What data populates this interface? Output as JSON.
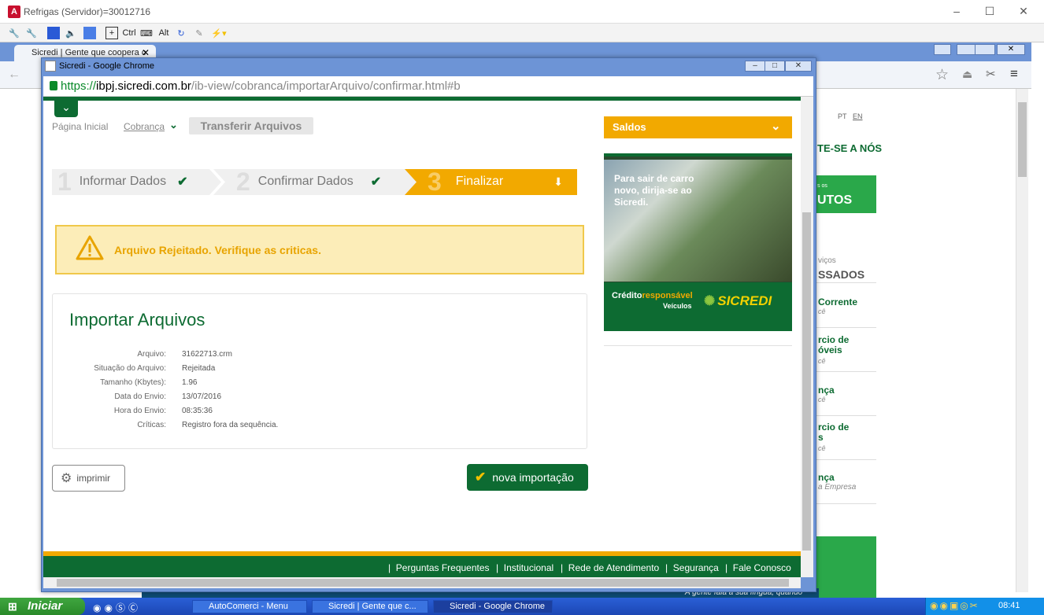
{
  "remote_window": {
    "title": "Refrigas (Servidor)=30012716",
    "toolbar": {
      "ctrl": "Ctrl",
      "alt": "Alt"
    }
  },
  "outer_browser": {
    "tab_label": "Sicredi | Gente que coopera c",
    "lang": {
      "pt": "PT",
      "en": "EN"
    },
    "side_heading": "TE-SE A NÓS",
    "green_block": {
      "small": "s os",
      "big": "UTOS"
    },
    "services_small": "viços",
    "services_heading": "SSADOS",
    "services": [
      {
        "title": "Corrente",
        "sub": "cê"
      },
      {
        "title": "rcio de\nóveis",
        "sub": "cê"
      },
      {
        "title": "nça",
        "sub": "cê"
      },
      {
        "title": "rcio de\ns",
        "sub": "cê"
      },
      {
        "title": "nça",
        "sub": "a Empresa"
      }
    ],
    "bottom_text": "A gente fala a sua língua, quando"
  },
  "popup": {
    "title": "Sicredi - Google Chrome",
    "url": {
      "scheme": "https://",
      "host": "ibpj.sicredi.com.br",
      "path": "/ib-view/cobranca/importarArquivo/confirmar.html#b"
    },
    "breadcrumb": {
      "home": "Página Inicial",
      "cobranca": "Cobrança",
      "current": "Transferir Arquivos"
    },
    "steps": [
      {
        "num": "1",
        "label": "Informar Dados"
      },
      {
        "num": "2",
        "label": "Confirmar Dados"
      },
      {
        "num": "3",
        "label": "Finalizar"
      }
    ],
    "alert": "Arquivo Rejeitado. Verifique as criticas.",
    "card": {
      "title": "Importar Arquivos",
      "rows": [
        {
          "label": "Arquivo:",
          "value": "31622713.crm"
        },
        {
          "label": "Situação do Arquivo:",
          "value": "Rejeitada"
        },
        {
          "label": "Tamanho (Kbytes):",
          "value": "1.96"
        },
        {
          "label": "Data do Envio:",
          "value": "13/07/2016"
        },
        {
          "label": "Hora do Envio:",
          "value": "08:35:36"
        },
        {
          "label": "Críticas:",
          "value": "Registro fora da sequência."
        }
      ]
    },
    "buttons": {
      "print": "imprimir",
      "new_import": "nova importação"
    },
    "saldos": "Saldos",
    "ad": {
      "text": "Para sair de carro novo, dirija-se ao Sicredi.",
      "credit_a": "Crédito",
      "credit_b": "responsável",
      "vehicles": "Veículos",
      "logo": "SICREDI"
    },
    "footer": [
      "Perguntas Frequentes",
      "Institucional",
      "Rede de Atendimento",
      "Segurança",
      "Fale Conosco"
    ]
  },
  "taskbar": {
    "start": "Iniciar",
    "items": [
      "AutoComerci - Menu",
      "Sicredi | Gente que c...",
      "Sicredi - Google Chrome"
    ],
    "clock": "08:41"
  },
  "colors": {
    "brand_green": "#0d6b32",
    "brand_yellow": "#f2a900",
    "alert_bg": "#fcedb8"
  }
}
